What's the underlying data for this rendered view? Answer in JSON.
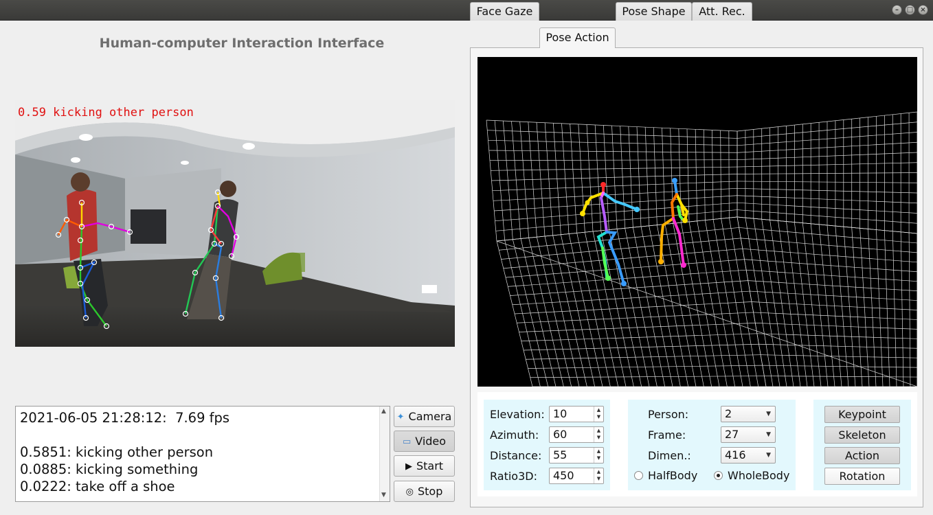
{
  "window": {
    "controls": [
      "–",
      "□",
      "×"
    ]
  },
  "app_title": "Human-computer Interaction Interface",
  "video": {
    "overlay_text": "0.59 kicking other person",
    "overlay_color": "#e01010"
  },
  "log": {
    "lines": "2021-06-05 21:28:12:  7.69 fps\n\n0.5851: kicking other person\n0.0885: kicking something\n0.0222: take off a shoe"
  },
  "side_buttons": {
    "camera": "Camera",
    "video": "Video",
    "start": "Start",
    "stop": "Stop"
  },
  "tabs": [
    "Face Gaze",
    "Pose Action",
    "Pose Shape",
    "Att. Rec."
  ],
  "active_tab": "Pose Action",
  "view_params": {
    "elevation_label": "Elevation:",
    "elevation": "10",
    "azimuth_label": "Azimuth:",
    "azimuth": "60",
    "distance_label": "Distance:",
    "distance": "55",
    "ratio_label": "Ratio3D:",
    "ratio": "450"
  },
  "data_params": {
    "person_label": "Person:",
    "person": "2",
    "frame_label": "Frame:",
    "frame": "27",
    "dimen_label": "Dimen.:",
    "dimen": "416",
    "halfbody": "HalfBody",
    "wholebody": "WholeBody",
    "body_mode": "WholeBody"
  },
  "action_buttons": {
    "keypoint": "Keypoint",
    "skeleton": "Skeleton",
    "action": "Action",
    "rotation": "Rotation"
  },
  "colors": {
    "panel_bg": "#e3f8fd",
    "plot_bg": "#000000",
    "grid": "#ffffff"
  }
}
